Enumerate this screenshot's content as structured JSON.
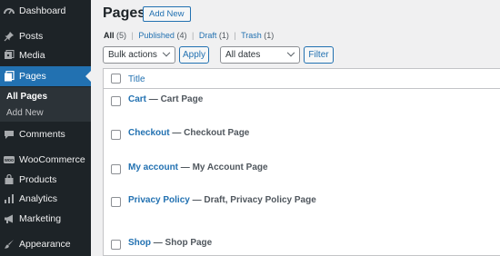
{
  "sidebar": {
    "items": [
      {
        "label": "Dashboard",
        "icon": "dashboard-icon"
      },
      {
        "label": "Posts",
        "icon": "pin-icon"
      },
      {
        "label": "Media",
        "icon": "media-icon"
      },
      {
        "label": "Pages",
        "icon": "pages-icon"
      },
      {
        "label": "Comments",
        "icon": "comment-icon"
      },
      {
        "label": "WooCommerce",
        "icon": "woo-icon"
      },
      {
        "label": "Products",
        "icon": "products-icon"
      },
      {
        "label": "Analytics",
        "icon": "analytics-icon"
      },
      {
        "label": "Marketing",
        "icon": "megaphone-icon"
      },
      {
        "label": "Appearance",
        "icon": "paintbrush-icon"
      }
    ],
    "submenu": [
      {
        "label": "All Pages"
      },
      {
        "label": "Add New"
      }
    ]
  },
  "header": {
    "title": "Pages",
    "add_new": "Add New"
  },
  "filters": {
    "all": "All",
    "all_count": "(5)",
    "published": "Published",
    "published_count": "(4)",
    "draft": "Draft",
    "draft_count": "(1)",
    "trash": "Trash",
    "trash_count": "(1)",
    "separator": "|"
  },
  "toolbar": {
    "bulk_actions": "Bulk actions",
    "apply": "Apply",
    "dates": "All dates",
    "filter": "Filter"
  },
  "table": {
    "column_title": "Title",
    "rows": [
      {
        "title": "Cart",
        "desc": " — Cart Page",
        "state": ""
      },
      {
        "title": "Checkout",
        "desc": " — Checkout Page",
        "state": ""
      },
      {
        "title": "My account",
        "desc": " — My Account Page",
        "state": ""
      },
      {
        "title": "Privacy Policy",
        "desc": " — Draft, Privacy Policy Page",
        "state": ""
      },
      {
        "title": "Shop",
        "desc": " — Shop Page",
        "state": ""
      }
    ]
  },
  "colors": {
    "sidebar_bg": "#1d2327",
    "accent": "#2271b1"
  }
}
